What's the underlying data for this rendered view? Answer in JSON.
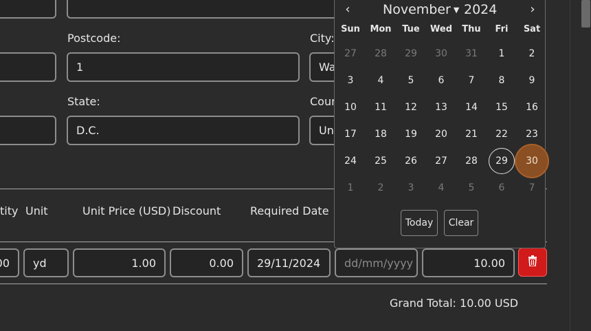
{
  "address": {
    "postcode_label": "Postcode:",
    "postcode_value": "1",
    "city_label": "City:",
    "city_value": "Wa",
    "state_label": "State:",
    "state_value": "D.C.",
    "country_label": "Cour",
    "country_value": "Un"
  },
  "table": {
    "headers": {
      "quantity": "tity",
      "unit": "Unit",
      "unit_price": "Unit Price (USD)",
      "discount": "Discount",
      "required_date": "Required Date"
    },
    "row": {
      "quantity": "00",
      "unit": "yd",
      "unit_price": "1.00",
      "discount": "0.00",
      "required_date": "29/11/2024",
      "date_placeholder": "dd/mm/yyyy",
      "line_total": "10.00"
    },
    "grand_total": "Grand Total: 10.00 USD"
  },
  "calendar": {
    "prev": "‹",
    "next": "›",
    "month": "November",
    "year": "2024",
    "weekdays": [
      "Sun",
      "Mon",
      "Tue",
      "Wed",
      "Thu",
      "Fri",
      "Sat"
    ],
    "weeks": [
      [
        "27",
        "28",
        "29",
        "30",
        "31",
        "1",
        "2"
      ],
      [
        "3",
        "4",
        "5",
        "6",
        "7",
        "8",
        "9"
      ],
      [
        "10",
        "11",
        "12",
        "13",
        "14",
        "15",
        "16"
      ],
      [
        "17",
        "18",
        "19",
        "20",
        "21",
        "22",
        "23"
      ],
      [
        "24",
        "25",
        "26",
        "27",
        "28",
        "29",
        "30"
      ],
      [
        "1",
        "2",
        "3",
        "4",
        "5",
        "6",
        "7"
      ]
    ],
    "today_button": "Today",
    "clear_button": "Clear"
  },
  "colors": {
    "background": "#2b2b2b",
    "delete_red": "#d11a1a",
    "hover_day": "#8a4f22"
  }
}
